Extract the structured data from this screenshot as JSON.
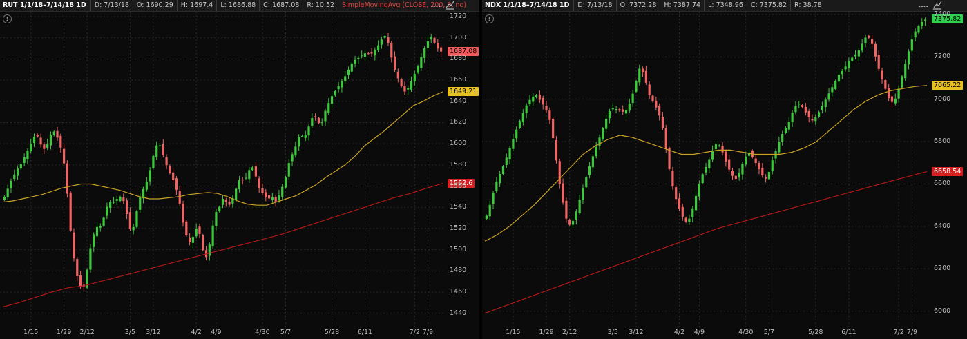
{
  "panels": [
    {
      "id": "left",
      "header": {
        "title": "RUT 1/1/18–7/14/18 1D",
        "cells": [
          "D: 7/13/18",
          "O: 1690.29",
          "H: 1697.4",
          "L: 1686.88",
          "C: 1687.08",
          "R: 10.52"
        ],
        "study": "SimpleMovingAvg (CLOSE, 200, 0, no)",
        "dots": "...."
      },
      "info_icon": "!",
      "price_tags": [
        {
          "label": "1687.08",
          "value": 1687.08,
          "color": "#f05a5a"
        },
        {
          "label": "1649.21",
          "value": 1649.21,
          "color": "#e8c020"
        },
        {
          "label": "1562.6",
          "value": 1562.6,
          "color": "#d42020",
          "text_color": "#ffffff"
        }
      ]
    },
    {
      "id": "right",
      "header": {
        "title": "NDX 1/1/18–7/14/18 1D",
        "cells": [
          "D: 7/13/18",
          "O: 7372.28",
          "H: 7387.74",
          "L: 7348.96",
          "C: 7375.82",
          "R: 38.78"
        ],
        "study": "",
        "dots": "...."
      },
      "info_icon": "!",
      "price_tags": [
        {
          "label": "7375.82",
          "value": 7375.82,
          "color": "#2fcf4f"
        },
        {
          "label": "7065.22",
          "value": 7065.22,
          "color": "#e8c020"
        },
        {
          "label": "6658.54",
          "value": 6658.54,
          "color": "#d42020",
          "text_color": "#ffffff"
        }
      ]
    }
  ],
  "colors": {
    "up": "#3ec83e",
    "down": "#f06464",
    "sma50": "#c9a227",
    "sma200": "#b01818",
    "grid": "#2a2a2a",
    "background": "#0b0b0b"
  },
  "chart_data": [
    {
      "type": "candlestick",
      "title": "RUT 1/1/18–7/14/18 1D",
      "ylim": [
        1430,
        1722
      ],
      "y_ticks": [
        1440,
        1460,
        1480,
        1500,
        1520,
        1540,
        1560,
        1580,
        1600,
        1620,
        1640,
        1660,
        1680,
        1700,
        1720
      ],
      "x_ticks": [
        "1/15",
        "1/29",
        "2/12",
        "3/5",
        "3/12",
        "4/2",
        "4/9",
        "4/30",
        "5/7",
        "5/28",
        "6/11",
        "7/2",
        "7/9"
      ],
      "x_tick_bar_index": [
        8,
        18,
        25,
        38,
        45,
        58,
        64,
        78,
        85,
        99,
        109,
        124,
        128
      ],
      "bar_count": 133,
      "closes": [
        1550,
        1558,
        1566,
        1572,
        1578,
        1582,
        1590,
        1596,
        1604,
        1610,
        1602,
        1594,
        1598,
        1608,
        1612,
        1606,
        1596,
        1580,
        1548,
        1510,
        1485,
        1470,
        1462,
        1468,
        1495,
        1510,
        1522,
        1520,
        1528,
        1540,
        1545,
        1545,
        1548,
        1550,
        1545,
        1530,
        1515,
        1525,
        1545,
        1555,
        1560,
        1570,
        1585,
        1598,
        1600,
        1590,
        1580,
        1572,
        1565,
        1555,
        1540,
        1520,
        1510,
        1505,
        1518,
        1522,
        1505,
        1490,
        1500,
        1520,
        1535,
        1540,
        1548,
        1545,
        1542,
        1550,
        1560,
        1568,
        1565,
        1570,
        1580,
        1575,
        1560,
        1555,
        1550,
        1548,
        1550,
        1545,
        1552,
        1560,
        1570,
        1585,
        1592,
        1600,
        1610,
        1605,
        1612,
        1622,
        1628,
        1620,
        1618,
        1630,
        1638,
        1645,
        1650,
        1655,
        1660,
        1665,
        1672,
        1678,
        1680,
        1682,
        1685,
        1686,
        1684,
        1688,
        1692,
        1698,
        1702,
        1695,
        1680,
        1668,
        1660,
        1652,
        1648,
        1655,
        1662,
        1670,
        1678,
        1688,
        1695,
        1702,
        1696,
        1690,
        1687
      ],
      "sma50": [
        1545,
        1546,
        1548,
        1550,
        1552,
        1555,
        1558,
        1560,
        1562,
        1562,
        1560,
        1558,
        1556,
        1553,
        1550,
        1548,
        1548,
        1549,
        1550,
        1552,
        1553,
        1554,
        1553,
        1550,
        1546,
        1543,
        1542,
        1542,
        1545,
        1548,
        1551,
        1556,
        1561,
        1568,
        1574,
        1580,
        1588,
        1598,
        1605,
        1612,
        1620,
        1628,
        1636,
        1640,
        1645,
        1649
      ],
      "sma200": [
        1446,
        1450,
        1455,
        1460,
        1464,
        1466,
        1470,
        1474,
        1478,
        1482,
        1486,
        1490,
        1494,
        1498,
        1502,
        1506,
        1510,
        1514,
        1519,
        1524,
        1529,
        1534,
        1539,
        1544,
        1549,
        1553,
        1558,
        1562.6
      ]
    },
    {
      "type": "candlestick",
      "title": "NDX 1/1/18–7/14/18 1D",
      "ylim": [
        5940,
        7400
      ],
      "y_ticks": [
        6000,
        6200,
        6400,
        6600,
        6800,
        7000,
        7200,
        7400
      ],
      "x_ticks": [
        "1/15",
        "1/29",
        "2/12",
        "3/5",
        "3/12",
        "4/2",
        "4/9",
        "4/30",
        "5/7",
        "5/28",
        "6/11",
        "7/2",
        "7/9"
      ],
      "x_tick_bar_index": [
        8,
        18,
        25,
        38,
        45,
        58,
        64,
        78,
        85,
        99,
        109,
        124,
        128
      ],
      "bar_count": 133,
      "closes": [
        6450,
        6520,
        6600,
        6650,
        6700,
        6760,
        6820,
        6880,
        6930,
        6980,
        7010,
        7020,
        6990,
        6960,
        6900,
        6780,
        6620,
        6500,
        6400,
        6420,
        6480,
        6560,
        6630,
        6700,
        6760,
        6820,
        6880,
        6940,
        6960,
        6950,
        6940,
        6950,
        7000,
        7080,
        7160,
        7100,
        7020,
        6980,
        6940,
        6860,
        6720,
        6600,
        6520,
        6460,
        6420,
        6440,
        6520,
        6600,
        6660,
        6700,
        6760,
        6800,
        6760,
        6700,
        6650,
        6620,
        6660,
        6720,
        6750,
        6720,
        6680,
        6640,
        6620,
        6700,
        6760,
        6820,
        6860,
        6900,
        6960,
        6980,
        6960,
        6920,
        6900,
        6920,
        6960,
        7000,
        7040,
        7080,
        7120,
        7140,
        7180,
        7200,
        7220,
        7260,
        7300,
        7280,
        7200,
        7120,
        7060,
        7000,
        6980,
        7040,
        7120,
        7200,
        7280,
        7330,
        7360,
        7375.82
      ],
      "sma50": [
        6330,
        6360,
        6400,
        6450,
        6500,
        6560,
        6620,
        6680,
        6740,
        6780,
        6810,
        6830,
        6820,
        6800,
        6780,
        6760,
        6740,
        6740,
        6750,
        6760,
        6760,
        6750,
        6740,
        6740,
        6740,
        6750,
        6770,
        6800,
        6850,
        6900,
        6950,
        6990,
        7020,
        7040,
        7050,
        7060,
        7065.22
      ],
      "sma200": [
        5990,
        6030,
        6070,
        6110,
        6150,
        6190,
        6230,
        6270,
        6310,
        6350,
        6390,
        6420,
        6450,
        6480,
        6510,
        6540,
        6570,
        6600,
        6630,
        6658.54
      ]
    }
  ]
}
